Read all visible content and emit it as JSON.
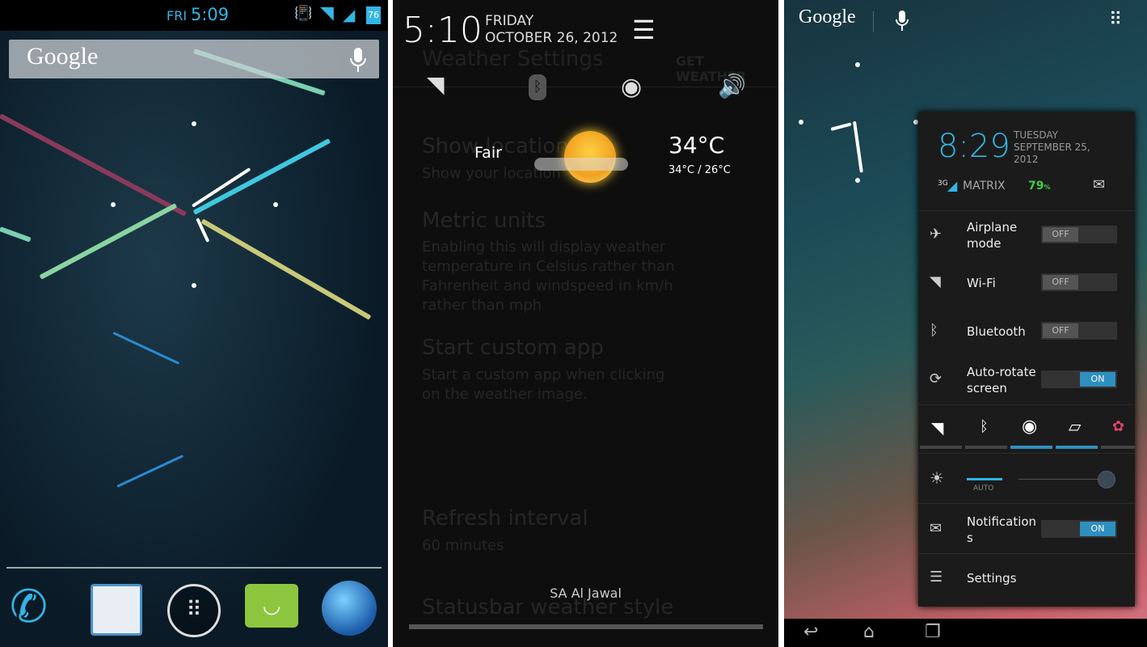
{
  "panel1": {
    "status": {
      "day": "FRI",
      "time": "5:09",
      "battery": "76"
    },
    "search": {
      "logo": "Google",
      "mic_icon": "mic-icon"
    },
    "dock": [
      {
        "name": "phone"
      },
      {
        "name": "contacts"
      },
      {
        "name": "apps"
      },
      {
        "name": "messaging"
      },
      {
        "name": "browser"
      }
    ],
    "colors": {
      "accent": "#33b5e5"
    }
  },
  "panel2": {
    "time": "5:10",
    "day": "FRIDAY",
    "date": "OCTOBER 26, 2012",
    "weather": {
      "condition": "Fair",
      "temp": "34°C",
      "range": "34°C / 26°C"
    },
    "carrier": "SA Al Jawal",
    "background": {
      "title": "Weather Settings",
      "action": "GET WEATHER",
      "items": [
        {
          "title": "Show location",
          "sub": "Show your location"
        },
        {
          "title": "Metric units",
          "sub": "Enabling this will display weather temperature in Celsius rather than Fahrenheit and windspeed in km/h rather than mph"
        },
        {
          "title": "Start custom app",
          "sub": "Start a custom app when clicking on the weather image."
        },
        {
          "title": "Refresh interval",
          "sub": "60 minutes"
        },
        {
          "title": "Statusbar weather style",
          "sub": ""
        }
      ]
    }
  },
  "panel3": {
    "logo": "Google",
    "header": {
      "time": "8:29",
      "day": "TUESDAY",
      "date": "SEPTEMBER 25,",
      "year": "2012",
      "network": "3G",
      "carrier": "MATRIX",
      "battery": "79",
      "battery_unit": "%"
    },
    "toggles": [
      {
        "label": "Airplane mode",
        "state": "OFF"
      },
      {
        "label": "Wi-Fi",
        "state": "OFF"
      },
      {
        "label": "Bluetooth",
        "state": "OFF"
      },
      {
        "label": "Auto-rotate screen",
        "state": "ON"
      }
    ],
    "brightness": {
      "auto": "AUTO",
      "level": 1.0
    },
    "notifications": {
      "label": "Notifications",
      "state": "ON"
    },
    "settings": "Settings"
  }
}
